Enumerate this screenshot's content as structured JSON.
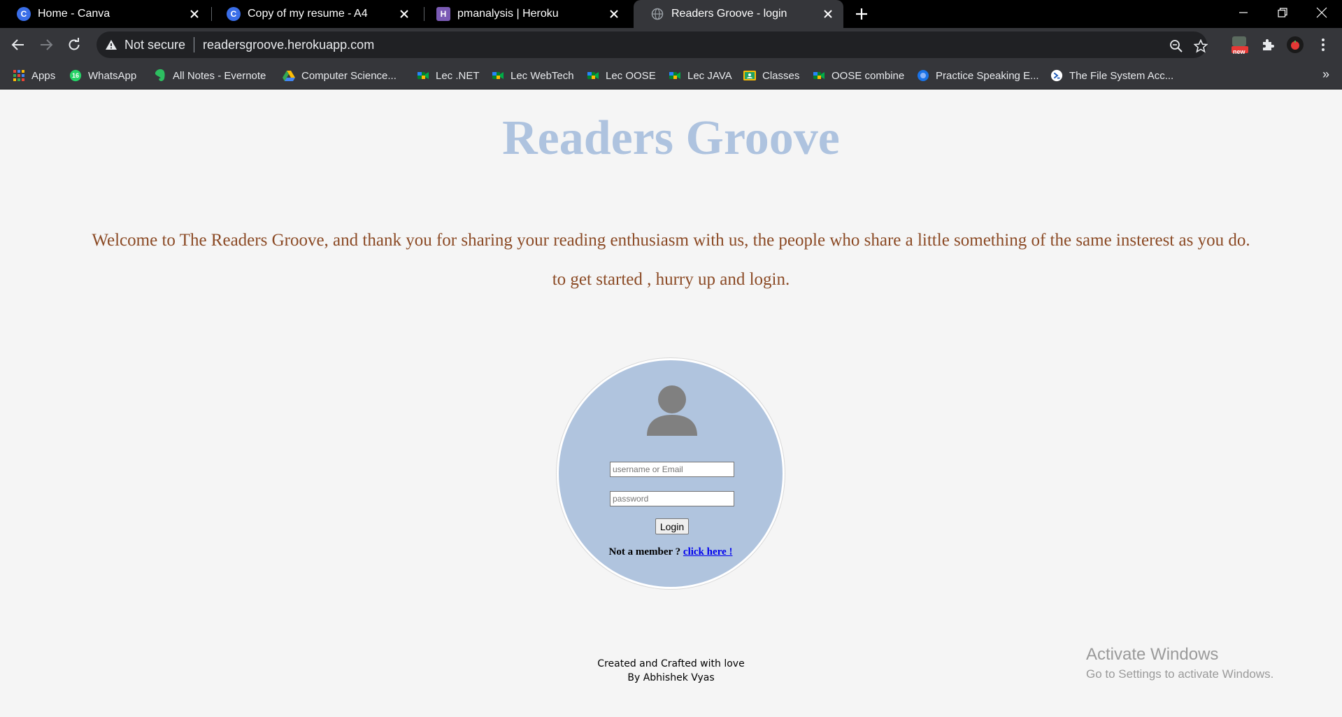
{
  "browser": {
    "tabs": [
      {
        "title": "Home - Canva",
        "icon": "canva-icon",
        "icon_letter": "C",
        "color": "#3a6ee8"
      },
      {
        "title": "Copy of my resume - A4",
        "icon": "canva-icon",
        "icon_letter": "C",
        "color": "#3a6ee8"
      },
      {
        "title": "pmanalysis | Heroku",
        "icon": "heroku-icon",
        "icon_letter": "H",
        "color": "#7b5bb5"
      },
      {
        "title": "Readers Groove - login",
        "icon": "globe-icon",
        "icon_letter": "",
        "color": "#9aa0a6"
      }
    ],
    "address": {
      "security": "Not secure",
      "url": "readersgroove.herokuapp.com"
    },
    "extension_badge": "new",
    "bookmarks": [
      {
        "label": "Apps",
        "icon": "apps-grid-icon"
      },
      {
        "label": "WhatsApp",
        "icon": "whatsapp-icon",
        "badge": "16"
      },
      {
        "label": "All Notes - Evernote",
        "icon": "evernote-icon"
      },
      {
        "label": "Computer Science...",
        "icon": "drive-icon"
      },
      {
        "label": "Lec .NET",
        "icon": "meet-icon"
      },
      {
        "label": "Lec WebTech",
        "icon": "meet-icon"
      },
      {
        "label": "Lec OOSE",
        "icon": "meet-icon"
      },
      {
        "label": "Lec JAVA",
        "icon": "meet-icon"
      },
      {
        "label": "Classes",
        "icon": "classroom-icon"
      },
      {
        "label": "OOSE combine",
        "icon": "meet-icon"
      },
      {
        "label": "Practice Speaking E...",
        "icon": "circle-blue-icon"
      },
      {
        "label": "The File System Acc...",
        "icon": "powershell-icon"
      }
    ],
    "bookmarks_more": "»"
  },
  "page": {
    "title": "Readers Groove",
    "welcome": "Welcome to The Readers Groove, and thank you for sharing your reading enthusiasm with us, the people who share a little something of the same insterest as you do.",
    "get_started": "to get started , hurry up and login.",
    "login": {
      "username_placeholder": "username or Email",
      "password_placeholder": "password",
      "button": "Login",
      "not_member": "Not a member ? ",
      "signup_link": "click here !"
    },
    "footer": {
      "line1": "Created and Crafted with love",
      "line2": "By Abhishek Vyas"
    },
    "watermark": {
      "title": "Activate Windows",
      "subtitle": "Go to Settings to activate Windows."
    }
  }
}
